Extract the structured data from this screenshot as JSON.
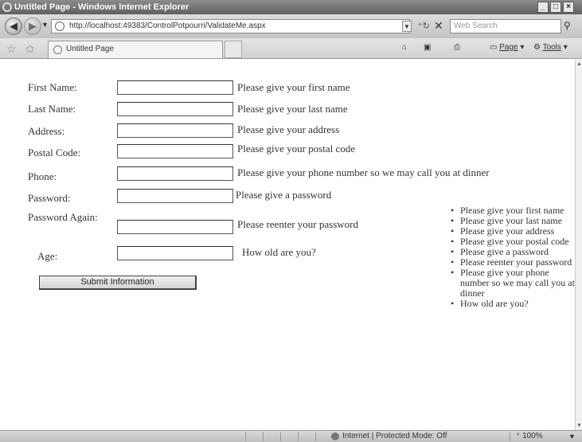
{
  "window": {
    "title": "Untitled Page - Windows Internet Explorer",
    "minimize": "_",
    "maximize": "□",
    "close": "×"
  },
  "nav": {
    "back": "◀",
    "forward": "▶",
    "recent": "▼",
    "url": "http://localhost:49383/ControlPotpourri/ValidateMe.aspx",
    "search_placeholder": "Web Search"
  },
  "tabs": {
    "active_label": "Untitled Page"
  },
  "commands": {
    "home": "⌂",
    "feeds": "▣",
    "print": "⎙",
    "page_label": "Page",
    "tools_label": "Tools"
  },
  "form": {
    "fields": [
      {
        "label": "First Name:",
        "value": "",
        "message": "Please give your first name"
      },
      {
        "label": "Last Name:",
        "value": "",
        "message": "Please give your last name"
      },
      {
        "label": "Address:",
        "value": "",
        "message": "Please give your address"
      },
      {
        "label": "Postal Code:",
        "value": "",
        "message": "Please give your postal code"
      },
      {
        "label": "Phone:",
        "value": "",
        "message": "Please give your phone number so we may call you at dinner"
      },
      {
        "label": "Password:",
        "value": "",
        "message": "Please give a password"
      },
      {
        "label": "Password Again:",
        "value": "",
        "message": "Please reenter your password"
      },
      {
        "label": "Age:",
        "value": "",
        "message": "How old are you?"
      }
    ],
    "submit_label": "Submit Information"
  },
  "summary": [
    "Please give your first name",
    "Please give your last name",
    "Please give your address",
    "Please give your postal code",
    "Please give a password",
    "Please reenter your password",
    "Please give your phone number so we may call you at dinner",
    "How old are you?"
  ],
  "status": {
    "zone": "Internet | Protected Mode: Off",
    "zoom": "100%"
  }
}
